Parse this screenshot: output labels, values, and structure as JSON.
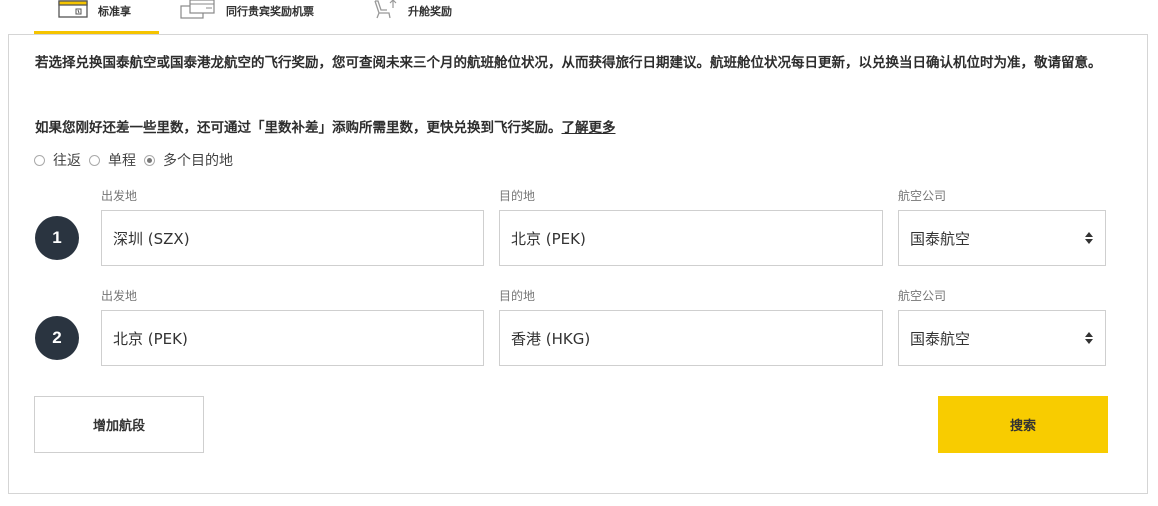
{
  "tabs": [
    {
      "label": "标准享",
      "icon": "calendar-icon",
      "active": true
    },
    {
      "label": "同行贵宾奖励机票",
      "icon": "tickets-icon",
      "active": false
    },
    {
      "label": "升舱奖励",
      "icon": "seat-upgrade-icon",
      "active": false
    }
  ],
  "colors": {
    "accent": "#f8cc00",
    "segment_badge": "#2a3440"
  },
  "notice": "若选择兑换国泰航空或国泰港龙航空的飞行奖励，您可查阅未来三个月的航班舱位状况，从而获得旅行日期建议。航班舱位状况每日更新，以兑换当日确认机位时为准，敬请留意。",
  "topup": {
    "text": "如果您刚好还差一些里数，还可通过「里数补差」添购所需里数，更快兑换到飞行奖励。",
    "link": "了解更多"
  },
  "trip_types": [
    {
      "label": "往返",
      "checked": false
    },
    {
      "label": "单程",
      "checked": false
    },
    {
      "label": "多个目的地",
      "checked": true
    }
  ],
  "segments": [
    {
      "number": "1",
      "origin_label": "出发地",
      "origin": "深圳 (SZX)",
      "destination_label": "目的地",
      "destination": "北京 (PEK)",
      "airline_label": "航空公司",
      "airline": "国泰航空"
    },
    {
      "number": "2",
      "origin_label": "出发地",
      "origin": "北京 (PEK)",
      "destination_label": "目的地",
      "destination": "香港 (HKG)",
      "airline_label": "航空公司",
      "airline": "国泰航空"
    }
  ],
  "buttons": {
    "add_segment": "增加航段",
    "search": "搜索"
  }
}
